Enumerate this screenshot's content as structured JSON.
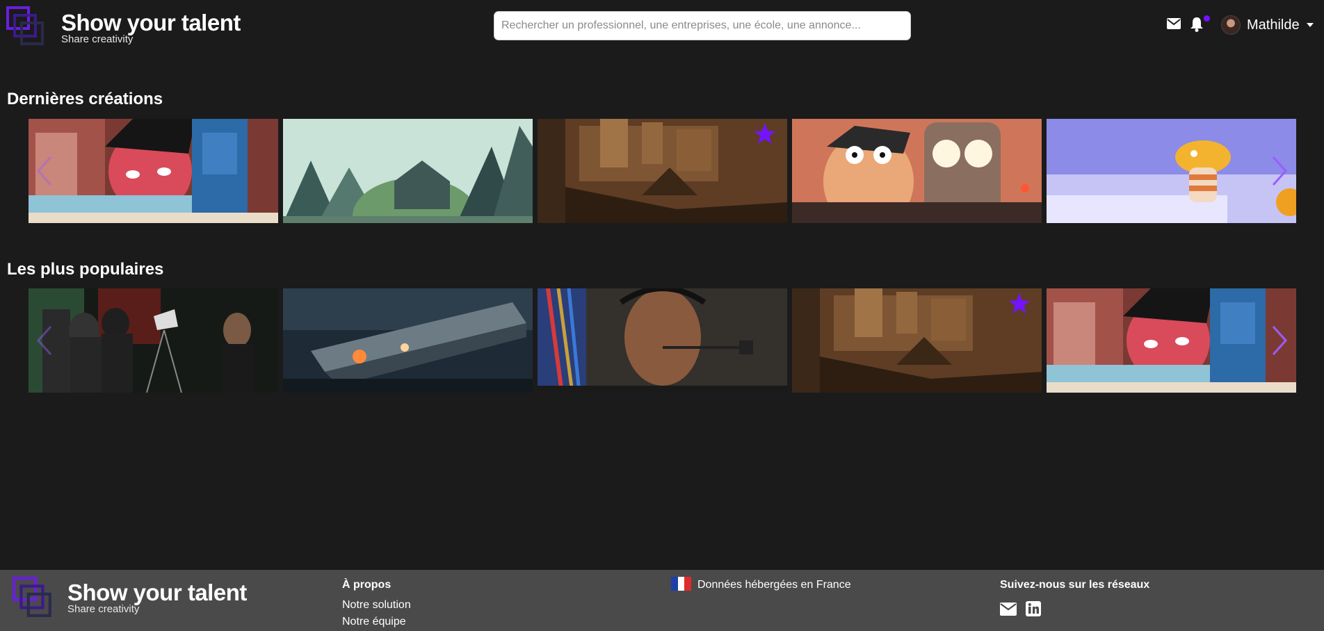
{
  "header": {
    "brand_title": "Show your talent",
    "brand_subtitle": "Share creativity",
    "search_placeholder": "Rechercher un professionnel, une entreprises, une école, une annonce...",
    "user_name": "Mathilde",
    "icons": [
      "mail-icon",
      "bell-icon",
      "chevron-down-icon"
    ]
  },
  "sections": [
    {
      "title": "Dernières créations",
      "cards": [
        {
          "name": "animated-boy-robot",
          "favorite": false
        },
        {
          "name": "forest-house-landscape",
          "favorite": false
        },
        {
          "name": "ruined-city-concept",
          "favorite": true
        },
        {
          "name": "glowing-robot-boy",
          "favorite": false
        },
        {
          "name": "mushroom-character",
          "favorite": false
        }
      ]
    },
    {
      "title": "Les plus populaires",
      "cards": [
        {
          "name": "film-set-crew",
          "favorite": false
        },
        {
          "name": "sci-fi-train",
          "favorite": false
        },
        {
          "name": "motion-capture-actress",
          "favorite": false
        },
        {
          "name": "ruined-city-concept",
          "favorite": true
        },
        {
          "name": "animated-boy-robot",
          "favorite": false
        }
      ]
    }
  ],
  "footer": {
    "brand_title": "Show your talent",
    "brand_subtitle": "Share creativity",
    "about_heading": "À propos",
    "about_links": [
      "Notre solution",
      "Notre équipe"
    ],
    "hosting_text": "Données hébergées en France",
    "social_heading": "Suivez-nous sur les réseaux",
    "social_icons": [
      "mail-icon",
      "linkedin-icon"
    ]
  },
  "colors": {
    "accent": "#7413ff",
    "background": "#1b1b1b",
    "footer": "#4a4a4a"
  }
}
